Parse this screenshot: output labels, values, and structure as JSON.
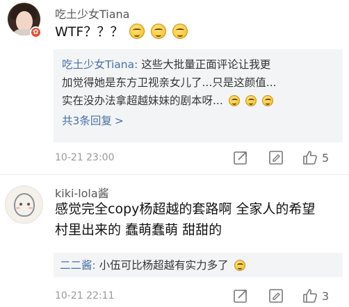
{
  "comments": [
    {
      "username": "吃土少女Tiana",
      "text": "WTF？？？",
      "reply": {
        "name": "吃土少女Tiana",
        "sep": ":",
        "lines": [
          "这些大批量正面评论让我更",
          "加觉得她是东方卫视亲女儿了...只是这颜值...",
          "实在没办法拿超越妹妹的剧本呀..."
        ],
        "more": "共3条回复",
        "more_caret": ">"
      },
      "time": "10-21 23:00",
      "likes": "5",
      "badge_icon": "verified-badge-icon"
    },
    {
      "username": "kiki-lola酱",
      "text_lines": [
        "感觉完全copy杨超越的套路啊 全家人的希望",
        "村里出来的 蠢萌蠢萌 甜甜的"
      ],
      "reply": {
        "name": "二二酱",
        "sep": ":",
        "text": " 小伍可比杨超越有实力多了"
      },
      "time": "10-21 22:11",
      "likes": "3"
    }
  ],
  "colors": {
    "link": "#4a6fa5",
    "meta": "#999999",
    "reply_bg": "#f2f4f6",
    "badge": "#e8502f"
  }
}
